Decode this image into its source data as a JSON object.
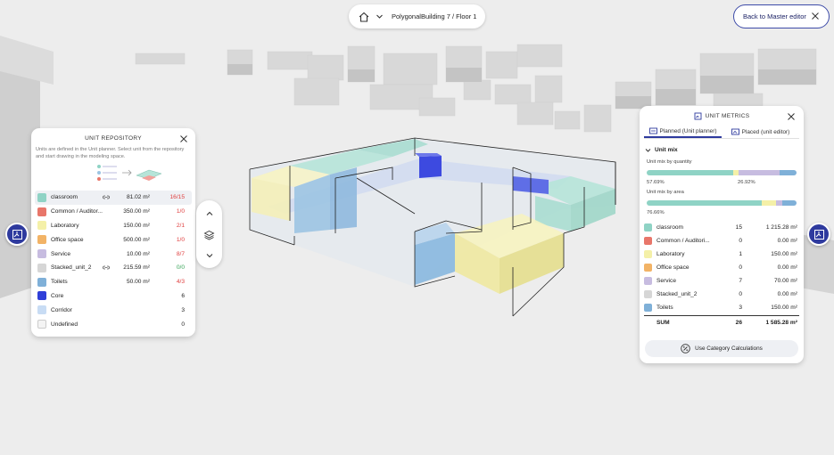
{
  "topbar": {
    "breadcrumb": "PolygonalBuilding 7 / Floor 1",
    "back_label": "Back to Master editor"
  },
  "unit_repository": {
    "title": "UNIT REPOSITORY",
    "description": "Units are defined in the Unit planner. Select unit from the repository and start drawing in the modeling space.",
    "units": [
      {
        "name": "classroom",
        "area": "81.02 m²",
        "count": "16/15",
        "count_color": "#e04040",
        "color": "#8fd3c5",
        "linked": true
      },
      {
        "name": "Common / Auditor...",
        "area": "350.00 m²",
        "count": "1/0",
        "count_color": "#e04040",
        "color": "#e8766a",
        "linked": false
      },
      {
        "name": "Laboratory",
        "area": "150.00 m²",
        "count": "2/1",
        "count_color": "#e04040",
        "color": "#f4f0a8",
        "linked": false
      },
      {
        "name": "Office space",
        "area": "500.00 m²",
        "count": "1/0",
        "count_color": "#e04040",
        "color": "#f2b366",
        "linked": false
      },
      {
        "name": "Service",
        "area": "10.00 m²",
        "count": "8/7",
        "count_color": "#e04040",
        "color": "#c7bce0",
        "linked": false
      },
      {
        "name": "Stacked_unit_2",
        "area": "215.59 m²",
        "count": "0/0",
        "count_color": "#3aa55a",
        "color": "#d6d6d6",
        "linked": true
      },
      {
        "name": "Toilets",
        "area": "50.00 m²",
        "count": "4/3",
        "count_color": "#e04040",
        "color": "#7fb0d8",
        "linked": false
      },
      {
        "name": "Core",
        "area": "",
        "count": "6",
        "count_color": "#222",
        "color": "#2f3fd8",
        "linked": false
      },
      {
        "name": "Corridor",
        "area": "",
        "count": "3",
        "count_color": "#222",
        "color": "#c8dcf4",
        "linked": false
      },
      {
        "name": "Undefined",
        "area": "",
        "count": "0",
        "count_color": "#222",
        "color": "#f4f4f4",
        "linked": false
      }
    ]
  },
  "unit_metrics": {
    "title": "UNIT METRICS",
    "tab_planned": "Planned (Unit planner)",
    "tab_placed": "Placed (unit editor)",
    "section": "Unit mix",
    "by_quantity_label": "Unit mix by quantity",
    "by_area_label": "Unit mix by area",
    "quantity_pct_left": "57.69%",
    "quantity_pct_right": "26.92%",
    "area_pct_left": "76.66%",
    "quantity_fractions": [
      0.5769,
      0.0,
      0.0385,
      0.0,
      0.2692,
      0.0,
      0.1154
    ],
    "area_fractions": [
      0.7666,
      0.0,
      0.0946,
      0.0,
      0.0442,
      0.0,
      0.0946
    ],
    "rows": [
      {
        "name": "classroom",
        "qty": "15",
        "area": "1 215.28 m²",
        "color": "#8fd3c5"
      },
      {
        "name": "Common / Auditori...",
        "qty": "0",
        "area": "0.00 m²",
        "color": "#e8766a"
      },
      {
        "name": "Laboratory",
        "qty": "1",
        "area": "150.00 m²",
        "color": "#f4f0a8"
      },
      {
        "name": "Office space",
        "qty": "0",
        "area": "0.00 m²",
        "color": "#f2b366"
      },
      {
        "name": "Service",
        "qty": "7",
        "area": "70.00 m²",
        "color": "#c7bce0"
      },
      {
        "name": "Stacked_unit_2",
        "qty": "0",
        "area": "0.00 m²",
        "color": "#d6d6d6"
      },
      {
        "name": "Toilets",
        "qty": "3",
        "area": "150.00 m²",
        "color": "#7fb0d8"
      }
    ],
    "sum_label": "SUM",
    "sum_qty": "26",
    "sum_area": "1 585.28 m²",
    "calc_button": "Use Category Calculations"
  }
}
